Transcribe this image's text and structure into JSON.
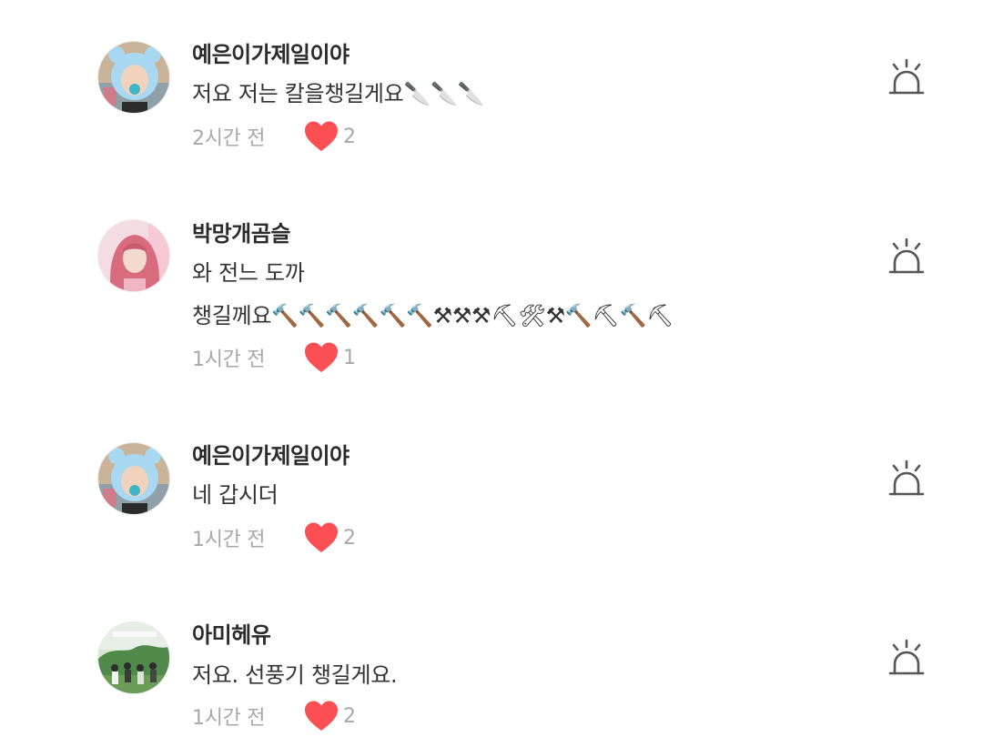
{
  "comments": [
    {
      "username": "예은이가제일이야",
      "lines": [
        "저요 저는 칼을챙길게요🔪🔪🔪"
      ],
      "time": "2시간 전",
      "likes": "2",
      "avatar": "bear-hat-selfie"
    },
    {
      "username": "박망개곰슬",
      "lines": [
        "와 전느 도까",
        "챙길께요🔨🔨🔨🔨🔨🔨⚒⚒⚒⛏🛠⚒🔨⛏🔨⛏"
      ],
      "time": "1시간 전",
      "likes": "1",
      "avatar": "pink-hair-portrait"
    },
    {
      "username": "예은이가제일이야",
      "lines": [
        "네 갑시더"
      ],
      "time": "1시간 전",
      "likes": "2",
      "avatar": "bear-hat-selfie"
    },
    {
      "username": "아미헤유",
      "lines": [
        "저요. 선풍기 챙길게요."
      ],
      "time": "1시간 전",
      "likes": "2",
      "avatar": "group-photo-outdoors"
    }
  ],
  "colors": {
    "heart": "#fb4f54",
    "meta_text": "#a8a8a8",
    "report_icon": "#555555"
  },
  "icons": {
    "like": "heart-icon",
    "report": "siren-icon"
  }
}
